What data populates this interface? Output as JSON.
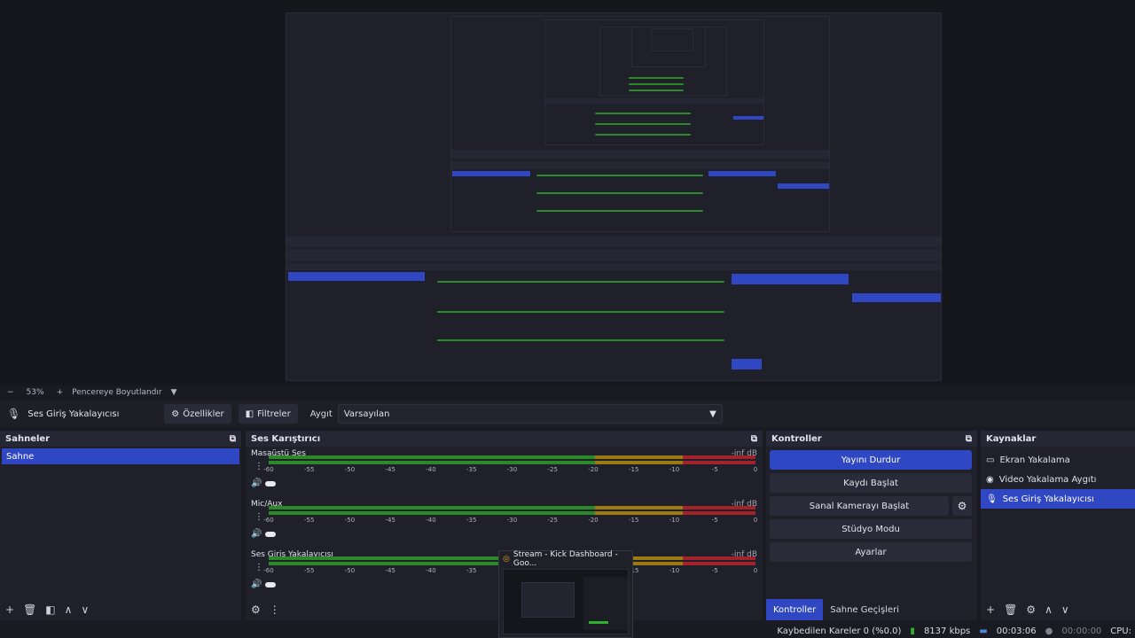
{
  "zoom": {
    "minus": "−",
    "value": "53%",
    "plus": "+",
    "fit_label": "Pencereye Boyutlandır",
    "dropdown": "▼"
  },
  "source_toolbar": {
    "source_name": "Ses Giriş Yakalayıcısı",
    "properties_label": "Özellikler",
    "filters_label": "Filtreler",
    "device_label": "Aygıt",
    "device_value": "Varsayılan"
  },
  "scenes": {
    "title": "Sahneler",
    "items": [
      "Sahne"
    ]
  },
  "mixer": {
    "title": "Ses Karıştırıcı",
    "ticks": [
      "-60",
      "-55",
      "-50",
      "-45",
      "-40",
      "-35",
      "-30",
      "-25",
      "-20",
      "-15",
      "-10",
      "-5",
      "0"
    ],
    "channels": [
      {
        "name": "Masaüstü Ses",
        "db": "-inf dB"
      },
      {
        "name": "Mic/Aux",
        "db": "-inf dB"
      },
      {
        "name": "Ses Giriş Yakalayıcısı",
        "db": "-inf dB"
      }
    ]
  },
  "controls": {
    "title": "Kontroller",
    "stop_stream": "Yayını Durdur",
    "start_recording": "Kaydı Başlat",
    "start_virtual_cam": "Sanal Kamerayı Başlat",
    "studio_mode": "Stüdyo Modu",
    "settings": "Ayarlar",
    "tabs": [
      "Kontroller",
      "Sahne Geçişleri"
    ]
  },
  "sources": {
    "title": "Kaynaklar",
    "items": [
      {
        "label": "Ekran Yakalama",
        "icon": "monitor-icon"
      },
      {
        "label": "Video Yakalama Aygıtı",
        "icon": "camera-icon"
      },
      {
        "label": "Ses Giriş Yakalayıcısı",
        "icon": "microphone-icon"
      }
    ]
  },
  "status": {
    "dropped_frames": "Kaybedilen Kareler 0 (%0.0)",
    "bitrate": "8137 kbps",
    "stream_time": "00:03:06",
    "record_time": "00:00:00",
    "cpu": "CPU:"
  },
  "thumbnail": {
    "title": "Stream - Kick Dashboard - Goo..."
  },
  "colors": {
    "accent": "#2f47c2",
    "meter_green": "#2a8a2a",
    "meter_yellow": "#9c7a12",
    "meter_red": "#a4222a"
  }
}
